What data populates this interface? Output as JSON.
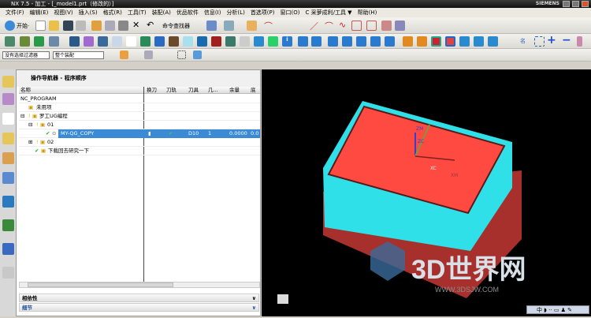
{
  "window": {
    "title": "NX 7.5 - 加工 - [_model1.prt（修改的）]",
    "brand": "SIEMENS"
  },
  "menu": [
    "文件(F)",
    "编辑(E)",
    "视图(V)",
    "插入(S)",
    "格式(R)",
    "工具(T)",
    "装配(A)",
    "优品软件",
    "信息(I)",
    "分析(L)",
    "首选项(P)",
    "窗口(O)",
    "C 采萝成利/工具 ▼",
    "帮助(H)"
  ],
  "toolbar": {
    "start_label": "开始·",
    "command_finder": "命令查找器"
  },
  "filters": {
    "selection_filter": "没有选择过滤器",
    "scope": "整个装配"
  },
  "navigator": {
    "title": "操作导航器 - 程序顺序",
    "columns": [
      "名称",
      "换刀",
      "刀轨",
      "刀具",
      "几...",
      "余量",
      "底"
    ],
    "rows": [
      {
        "name": "NC_PROGRAM"
      },
      {
        "name": "未用项"
      },
      {
        "name": "罗工UG编程"
      },
      {
        "name": "01"
      },
      {
        "name": "MY-QG_COPY",
        "tool": "D10",
        "geom": "1",
        "stock": "0.0000",
        "floor": "0.0",
        "selected": true
      },
      {
        "name": "02"
      },
      {
        "name": "下载回去研究一下"
      }
    ],
    "sections": [
      "相依性",
      "细节"
    ]
  },
  "viewport": {
    "axes": {
      "zm": "ZM",
      "zc": "ZC",
      "xc": "XC",
      "xm": "XM"
    },
    "watermark": "3D世界网",
    "watermark_url": "WWW.3DSJW.COM"
  },
  "ime": {
    "label": "中"
  }
}
